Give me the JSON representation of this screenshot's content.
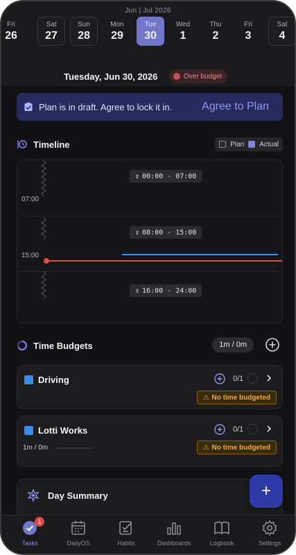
{
  "header": {
    "month_label": "Jun | Jul 2026",
    "days": [
      {
        "dow": "Fri",
        "num": "26"
      },
      {
        "dow": "Sat",
        "num": "27"
      },
      {
        "dow": "Sun",
        "num": "28"
      },
      {
        "dow": "Mon",
        "num": "29"
      },
      {
        "dow": "Tue",
        "num": "30"
      },
      {
        "dow": "Wed",
        "num": "1"
      },
      {
        "dow": "Thu",
        "num": "2"
      },
      {
        "dow": "Fri",
        "num": "3"
      },
      {
        "dow": "Sat",
        "num": "4"
      }
    ],
    "selected_index": 4
  },
  "date_row": {
    "title": "Tuesday, Jun 30, 2026",
    "badge": "Over budget"
  },
  "draft_banner": {
    "message": "Plan is in draft. Agree to lock it in.",
    "action": "Agree to Plan"
  },
  "timeline": {
    "title": "Timeline",
    "legend": {
      "plan": "Plan",
      "actual": "Actual"
    },
    "hour_labels": [
      "07:00",
      "15:00"
    ],
    "ranges": [
      "00:00 - 07:00",
      "08:00 - 15:00",
      "16:00 - 24:00"
    ],
    "colors": {
      "now_line": "#e04a48",
      "plan_line": "#3b8ee8"
    }
  },
  "time_budgets": {
    "title": "Time Budgets",
    "total": "1m / 0m",
    "items": [
      {
        "name": "Driving",
        "count": "0/1",
        "warning": "No time budgeted"
      },
      {
        "name": "Lotti Works",
        "count": "0/1",
        "progress": "1m / 0m",
        "warning": "No time budgeted"
      }
    ]
  },
  "day_summary": {
    "title": "Day Summary"
  },
  "fab": {
    "label": "+"
  },
  "tabbar": {
    "tabs": [
      {
        "label": "Tasks",
        "badge": "1"
      },
      {
        "label": "DailyOS"
      },
      {
        "label": "Habits"
      },
      {
        "label": "Dashboards"
      },
      {
        "label": "Logbook"
      },
      {
        "label": "Settings"
      }
    ]
  },
  "colors": {
    "accent": "#7077c8",
    "background": "#121214",
    "warning": "#f0a840"
  }
}
